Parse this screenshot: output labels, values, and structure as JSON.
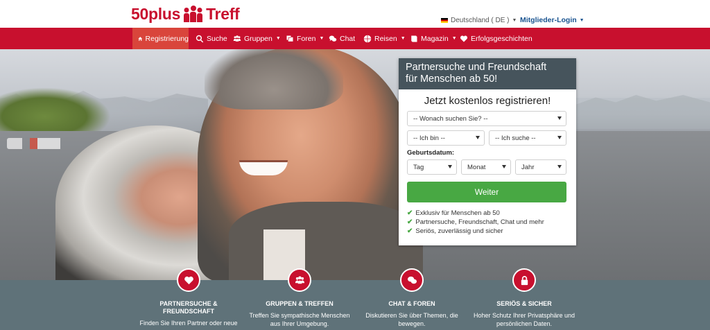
{
  "logo": {
    "left": "50plus",
    "right": "Treff"
  },
  "header": {
    "language": "Deutschland ( DE )",
    "login": "Mitglieder-Login"
  },
  "nav": [
    {
      "label": "Registrierung",
      "icon": "home-icon",
      "active": true
    },
    {
      "label": "Suche",
      "icon": "search-icon"
    },
    {
      "label": "Gruppen",
      "icon": "group-icon",
      "dropdown": true
    },
    {
      "label": "Foren",
      "icon": "forum-icon",
      "dropdown": true
    },
    {
      "label": "Chat",
      "icon": "chat-icon"
    },
    {
      "label": "Reisen",
      "icon": "globe-icon",
      "dropdown": true
    },
    {
      "label": "Magazin",
      "icon": "book-icon",
      "dropdown": true
    },
    {
      "label": "Erfolgsgeschichten",
      "icon": "heart-icon"
    }
  ],
  "register": {
    "title_line1": "Partnersuche und Freundschaft",
    "title_line2": "für Menschen ab 50!",
    "subtitle": "Jetzt kostenlos registrieren!",
    "search_for": "-- Wonach suchen Sie? --",
    "i_am": "-- Ich bin --",
    "i_seek": "-- Ich suche --",
    "birthdate_label": "Geburtsdatum:",
    "day": "Tag",
    "month": "Monat",
    "year": "Jahr",
    "submit": "Weiter",
    "features": [
      "Exklusiv für Menschen ab 50",
      "Partnersuche, Freundschaft, Chat und mehr",
      "Seriös, zuverlässig und sicher"
    ]
  },
  "feature_strip": [
    {
      "icon": "heart-icon",
      "title_line1": "PARTNERSUCHE &",
      "title_line2": "FREUNDSCHAFT",
      "desc_line1": "Finden Sie Ihren Partner oder neue",
      "desc_line2": ""
    },
    {
      "icon": "group-icon",
      "title_line1": "GRUPPEN & TREFFEN",
      "title_line2": "",
      "desc_line1": "Treffen Sie sympathische Menschen",
      "desc_line2": "aus Ihrer Umgebung."
    },
    {
      "icon": "chat-icon",
      "title_line1": "CHAT & FOREN",
      "title_line2": "",
      "desc_line1": "Diskutieren Sie über Themen, die",
      "desc_line2": "bewegen."
    },
    {
      "icon": "lock-icon",
      "title_line1": "SERIÖS & SICHER",
      "title_line2": "",
      "desc_line1": "Hoher Schutz Ihrer Privatsphäre und",
      "desc_line2": "persönlichen Daten."
    }
  ],
  "colors": {
    "brand_red": "#c8102e",
    "nav_active": "#d9453b",
    "box_header": "#46545c",
    "button_green": "#48a843",
    "strip": "#5f7279",
    "link_blue": "#1a5490"
  }
}
